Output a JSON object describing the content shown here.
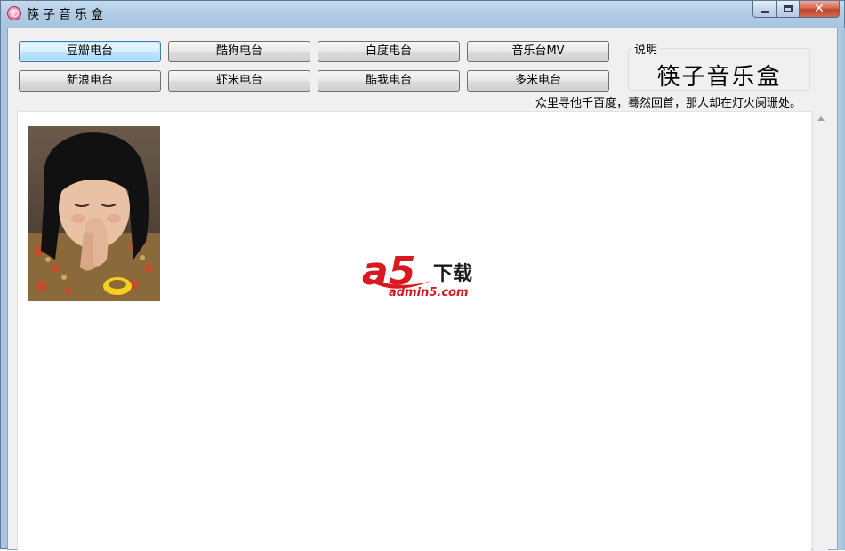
{
  "window": {
    "title": "筷子音乐盒",
    "controls": {
      "minimize": "minimize-icon",
      "maximize": "maximize-icon",
      "close": "close-icon",
      "close_glyph": "✕"
    }
  },
  "stations": {
    "row1": [
      "豆瓣电台",
      "酷狗电台",
      "白度电台",
      "音乐台MV"
    ],
    "row2": [
      "新浪电台",
      "虾米电台",
      "酷我电台",
      "多米电台"
    ]
  },
  "info": {
    "caption": "说明",
    "title": "筷子音乐盒",
    "tagline": "众里寻他千百度，蓦然回首，那人却在灯火阑珊处。"
  },
  "watermark": {
    "logo": "a5",
    "text": "下载",
    "url": "admin5.com"
  },
  "colors": {
    "accent": "#3c7fb1",
    "watermark_red": "#d8191f"
  }
}
